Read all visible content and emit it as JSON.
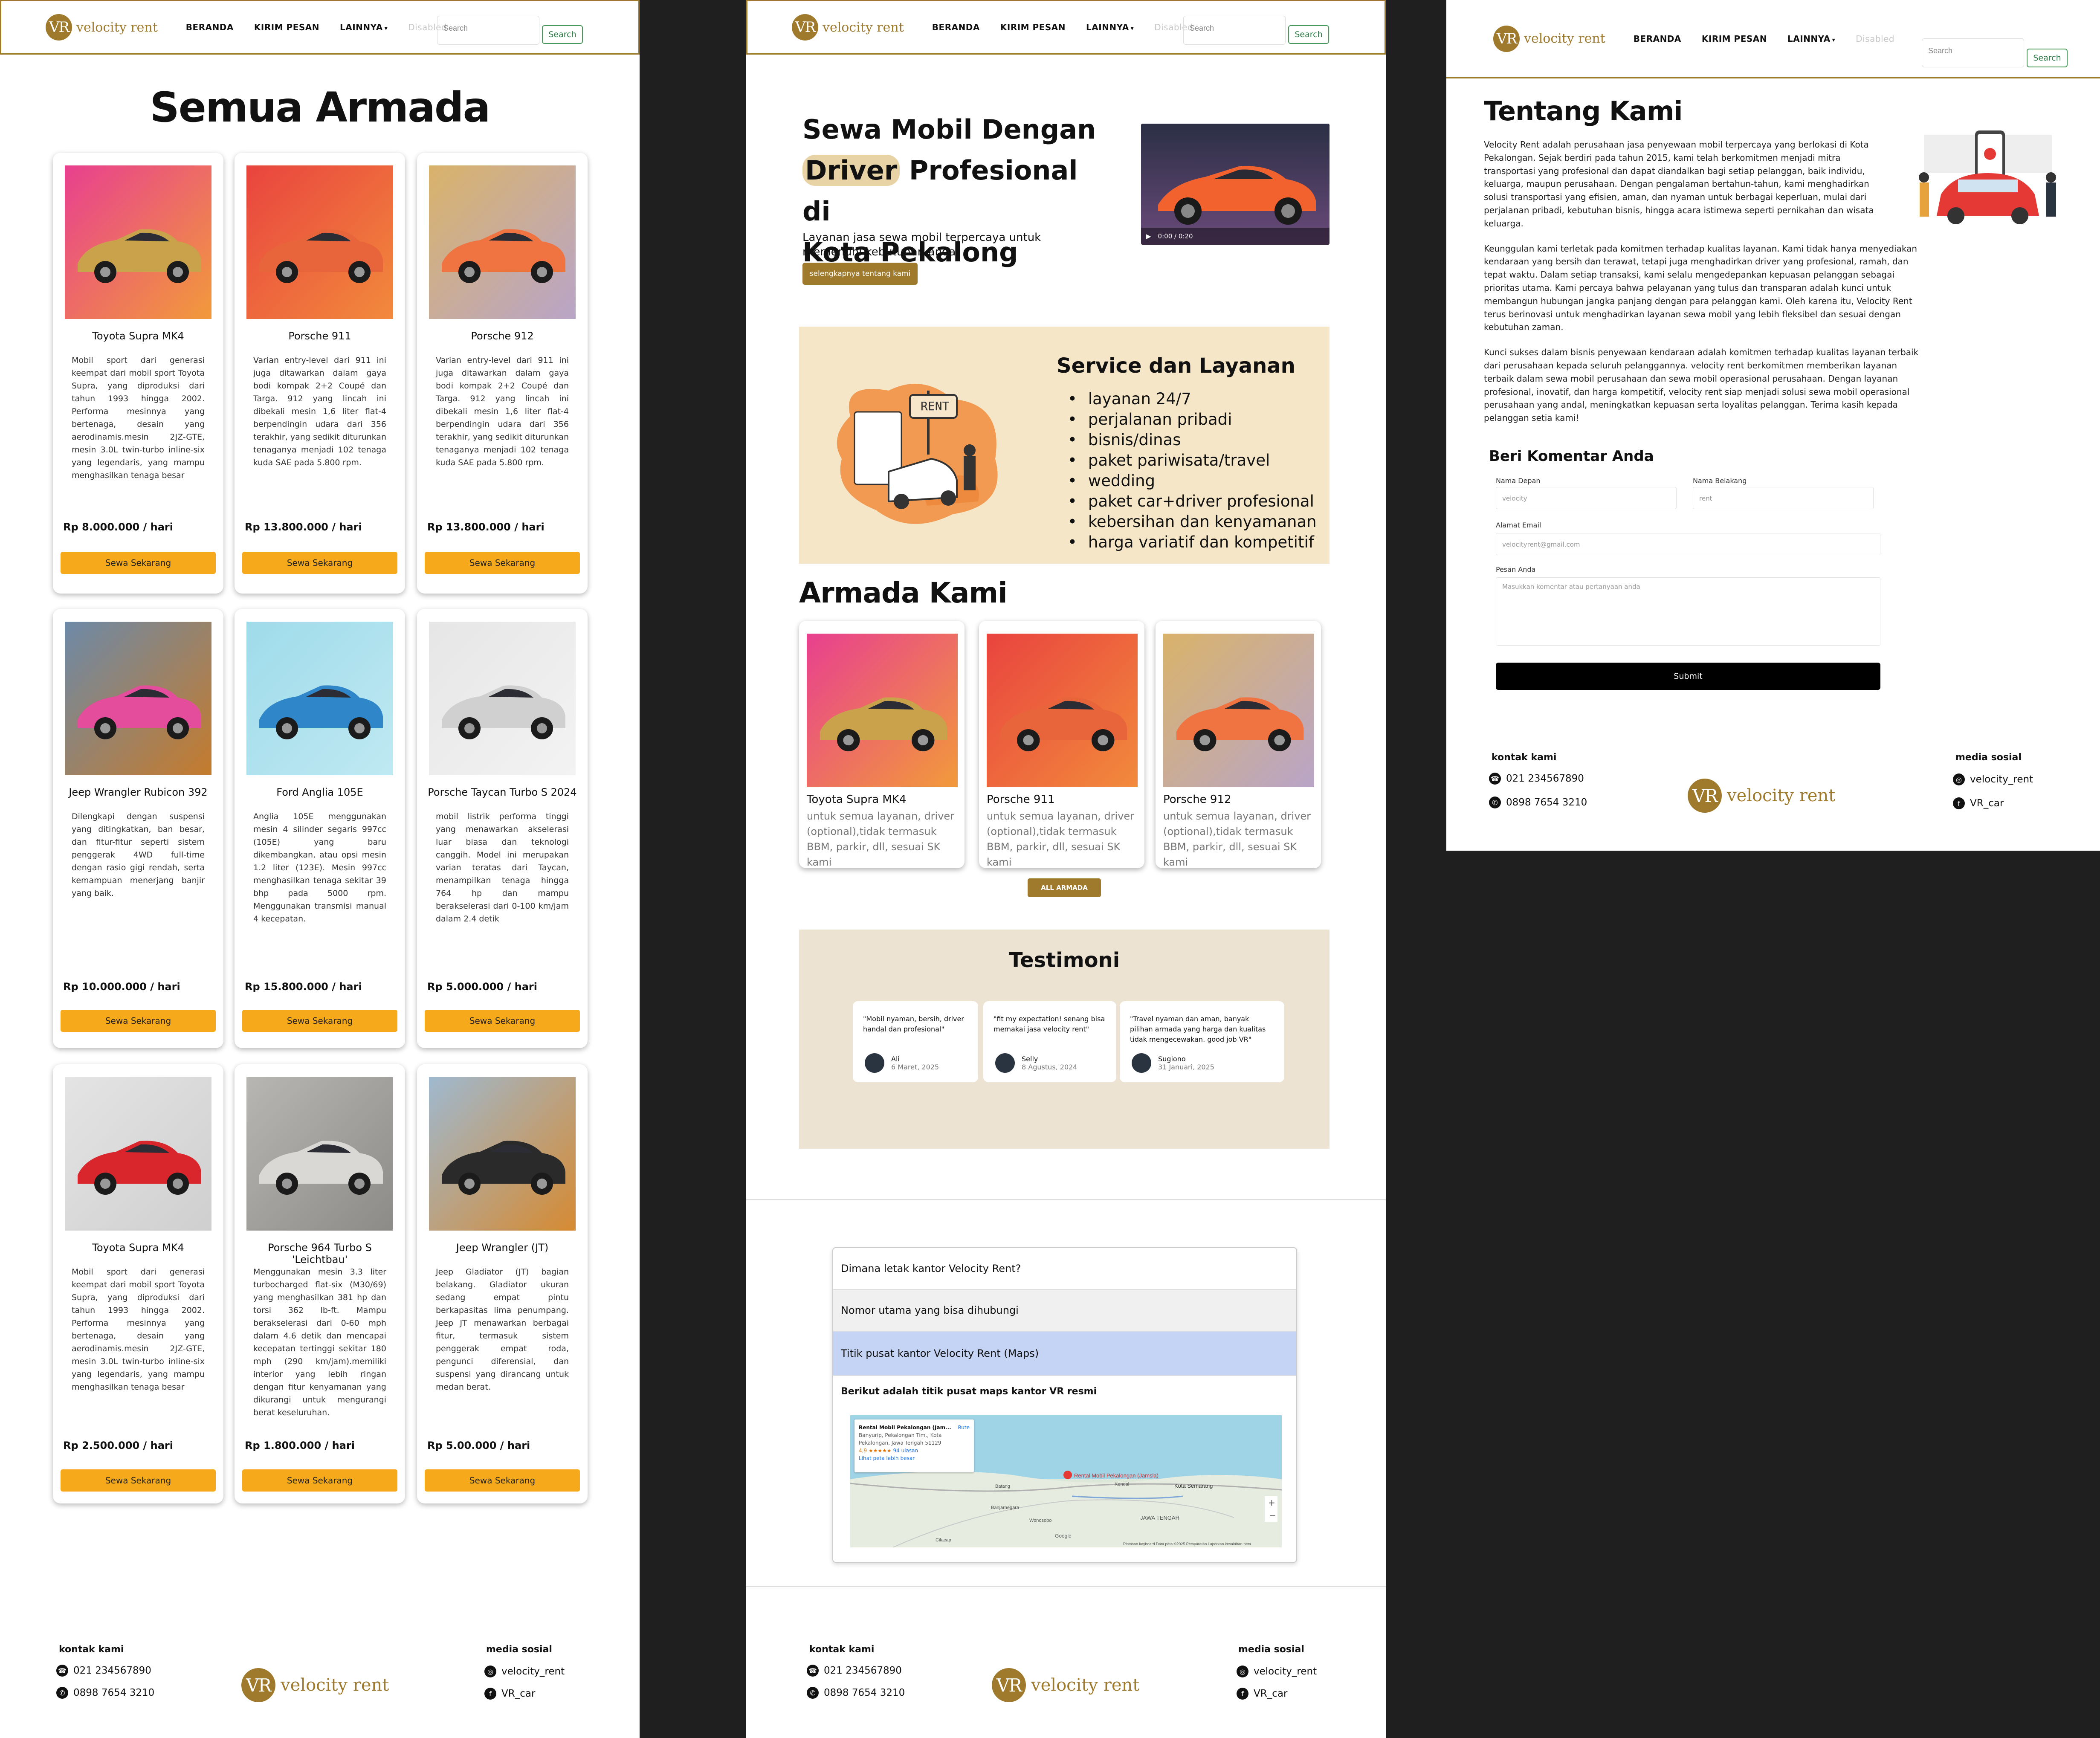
{
  "nav": {
    "logo_initials": "VR",
    "logo_text": "velocity rent",
    "links": [
      "BERANDA",
      "KIRIM PESAN",
      "LAINNYA"
    ],
    "disabled": "Disabled",
    "search_placeholder": "Search",
    "search_button": "Search"
  },
  "catalog": {
    "title": "Semua Armada",
    "button_label": "Sewa Sekarang",
    "cars": [
      {
        "name": "Toyota Supra MK4",
        "desc": "Mobil sport dari generasi keempat dari mobil sport Toyota Supra, yang diproduksi dari tahun 1993 hingga 2002. Performa mesinnya yang bertenaga, desain yang aerodinamis.mesin 2JZ-GTE, mesin 3.0L twin-turbo inline-six yang legendaris, yang mampu menghasilkan tenaga besar",
        "price": "Rp 8.000.000 / hari",
        "image": "supra-pink-bg",
        "colors": [
          "#e8408f",
          "#f29a3a",
          "#c9a24b"
        ]
      },
      {
        "name": "Porsche 911",
        "desc": "Varian entry-level dari 911 ini juga ditawarkan dalam gaya bodi kompak 2+2 Coupé dan Targa. 912 yang lincah ini dibekali mesin 1,6 liter flat-4 berpendingin udara dari 356 terakhir, yang sedikit diturunkan tenaganya menjadi 102 tenaga kuda SAE pada 5.800 rpm.",
        "price": "Rp 13.800.000 / hari",
        "image": "porsche911-orange-bg",
        "colors": [
          "#e9443e",
          "#f28a3c",
          "#e8643a"
        ]
      },
      {
        "name": "Porsche 912",
        "desc": "Varian entry-level dari 911 ini juga ditawarkan dalam gaya bodi kompak 2+2 Coupé dan Targa. 912 yang lincah ini dibekali mesin 1,6 liter flat-4 berpendingin udara dari 356 terakhir, yang sedikit diturunkan tenaganya menjadi 102 tenaga kuda SAE pada 5.800 rpm.",
        "price": "Rp 13.800.000 / hari",
        "image": "porsche912-peach-bg",
        "colors": [
          "#d9b36a",
          "#b9a5c8",
          "#ef7442"
        ]
      },
      {
        "name": "Jeep Wrangler Rubicon 392",
        "desc": "Dilengkapi dengan suspensi yang ditingkatkan, ban besar, dan fitur-fitur seperti sistem penggerak 4WD full-time dengan rasio gigi rendah, serta kemampuan menerjang banjir yang baik.",
        "price": "Rp 10.000.000 / hari",
        "image": "jeep-autumn-mountains",
        "colors": [
          "#6d8aa8",
          "#c57b2c",
          "#e34d9b"
        ]
      },
      {
        "name": "Ford Anglia 105E",
        "desc": "Anglia 105E menggunakan mesin 4 silinder segaris 997cc (105E) yang baru dikembangkan, atau opsi mesin 1.2 liter (123E). Mesin 997cc menghasilkan tenaga sekitar 39 bhp pada 5000 rpm. Menggunakan transmisi manual 4 kecepatan.",
        "price": "Rp 15.800.000 / hari",
        "image": "anglia-blue-bg",
        "colors": [
          "#9fdbea",
          "#bfe9f2",
          "#2f86c9"
        ]
      },
      {
        "name": "Porsche Taycan Turbo S 2024",
        "desc": "mobil listrik performa tinggi yang menawarkan akselerasi luar biasa dan teknologi canggih. Model ini merupakan varian teratas dari Taycan, menampilkan tenaga hingga 764 hp dan mampu berakselerasi dari 0-100 km/jam dalam 2.4 detik",
        "price": "Rp 5.000.000 / hari",
        "image": "taycan-white-studio",
        "colors": [
          "#e6e6e6",
          "#f3f3f3",
          "#d0d0d0"
        ]
      },
      {
        "name": "Toyota Supra MK4",
        "desc": "Mobil sport dari generasi keempat dari mobil sport Toyota Supra, yang diproduksi dari tahun 1993 hingga 2002. Performa mesinnya yang bertenaga, desain yang aerodinamis.mesin 2JZ-GTE, mesin 3.0L twin-turbo inline-six yang legendaris, yang mampu menghasilkan tenaga besar",
        "price": "Rp 2.500.000 / hari",
        "image": "red-hatchback-grey-studio",
        "colors": [
          "#e4e4e4",
          "#cfcfcf",
          "#d8262c"
        ]
      },
      {
        "name": "Porsche 964 Turbo S 'Leichtbau'",
        "desc": "Menggunakan mesin 3.3 liter turbocharged flat-six (M30/69) yang menghasilkan 381 hp dan torsi 362 lb-ft. Mampu berakselerasi dari 0-60 mph dalam 4.6 detik dan mencapai kecepatan tertinggi sekitar 180 mph (290 km/jam).memiliki interior yang lebih ringan dengan fitur kenyamanan yang dikurangi untuk mengurangi berat keseluruhan.",
        "price": "Rp 1.800.000 / hari",
        "image": "porsche964-silver-studio",
        "colors": [
          "#b8b6b2",
          "#8d8b88",
          "#d9d8d4"
        ]
      },
      {
        "name": "Jeep Wrangler (JT)",
        "desc": "Jeep Gladiator (JT) bagian belakang. Gladiator ukuran sedang empat pintu berkapasitas lima penumpang. Jeep JT menawarkan berbagai fitur, termasuk sistem penggerak empat roda, pengunci diferensial, dan suspensi yang dirancang untuk medan berat.",
        "price": "Rp 5.00.000 / hari",
        "image": "jeep-black-mountains",
        "colors": [
          "#9fb9cf",
          "#d68a32",
          "#2a2a2a"
        ]
      }
    ]
  },
  "home": {
    "hero_line1": "Sewa Mobil Dengan",
    "hero_highlight": "Driver",
    "hero_line2_rest": " Profesional di",
    "hero_line3": "Kota Pekalong",
    "hero_sub": "Layanan jasa sewa mobil terpercaya untuk memenuhi kebutuhan anda",
    "hero_button": "selengkapnya tentang kami",
    "video_time": "0:00 / 0:20",
    "service_title": "Service dan Layanan",
    "service_rent_sign": "RENT",
    "services": [
      "layanan 24/7",
      "perjalanan pribadi",
      "bisnis/dinas",
      "paket pariwisata/travel",
      "wedding",
      "paket car+driver profesional",
      "kebersihan dan kenyamanan",
      "harga variatif dan kompetitif"
    ],
    "armada_title": "Armada Kami",
    "armada_desc": "untuk semua layanan, driver (optional),tidak termasuk BBM, parkir, dll, sesuai SK kami",
    "armada_names": [
      "Toyota Supra MK4",
      "Porsche 911",
      "Porsche 912"
    ],
    "all_button": "ALL ARMADA",
    "testimoni_title": "Testimoni",
    "testimonials": [
      {
        "quote": "\"Mobil nyaman, bersih, driver handal dan profesional\"",
        "name": "Ali",
        "date": "6 Maret, 2025"
      },
      {
        "quote": "\"fit my expectation! senang bisa memakai jasa velocity rent\"",
        "name": "Selly",
        "date": "8 Agustus, 2024"
      },
      {
        "quote": "\"Travel nyaman dan aman, banyak pilihan armada yang harga dan kualitas tidak mengecewakan. good job VR\"",
        "name": "Sugiono",
        "date": "31 Januari, 2025"
      }
    ],
    "faq": [
      "Dimana letak kantor Velocity Rent?",
      "Nomor utama yang bisa dihubungi",
      "Titik pusat kantor Velocity Rent (Maps)"
    ],
    "faq_answer": "Berikut adalah titik pusat maps kantor VR resmi",
    "map_title": "Rental Mobil Pekalongan (Jam...",
    "map_addr": "Banyurip, Pekalongan Tim., Kota Pekalongan, Jawa Tengah 51129",
    "map_rating": "4,9 ★★★★★",
    "map_reviews": "94 ulasan",
    "map_link": "Lihat peta lebih besar",
    "map_route": "Rute",
    "map_pin_label": "Rental Mobil Pekalongan (Jamsla)",
    "map_places": [
      "Kota Semarang",
      "JAWA TENGAH",
      "Batang",
      "Kendal",
      "Banjarnegara",
      "Wonosobo",
      "Cilacap"
    ],
    "map_credits": "Pintasan keyboard   Data peta ©2025   Persyaratan   Laporkan kesalahan peta",
    "map_google": "Google"
  },
  "about": {
    "title": "Tentang Kami",
    "paragraphs": [
      "Velocity Rent adalah perusahaan jasa penyewaan mobil terpercaya yang berlokasi di Kota Pekalongan. Sejak berdiri pada tahun 2015, kami telah berkomitmen menjadi mitra transportasi yang profesional dan dapat diandalkan bagi setiap pelanggan, baik individu, keluarga, maupun perusahaan. Dengan pengalaman bertahun-tahun, kami menghadirkan solusi transportasi yang efisien, aman, dan nyaman untuk berbagai keperluan, mulai dari perjalanan pribadi, kebutuhan bisnis, hingga acara istimewa seperti pernikahan dan wisata keluarga.",
      "Keunggulan kami terletak pada komitmen terhadap kualitas layanan. Kami tidak hanya menyediakan kendaraan yang bersih dan terawat, tetapi juga menghadirkan driver yang profesional, ramah, dan tepat waktu. Dalam setiap transaksi, kami selalu mengedepankan kepuasan pelanggan sebagai prioritas utama. Kami percaya bahwa pelayanan yang tulus dan transparan adalah kunci untuk membangun hubungan jangka panjang dengan para pelanggan kami. Oleh karena itu, Velocity Rent terus berinovasi untuk menghadirkan layanan sewa mobil yang lebih fleksibel dan sesuai dengan kebutuhan zaman.",
      "Kunci sukses dalam bisnis penyewaan kendaraan adalah komitmen terhadap kualitas layanan terbaik dari perusahaan kepada seluruh pelanggannya. velocity rent berkomitmen memberikan layanan terbaik dalam sewa mobil perusahaan dan sewa mobil operasional perusahaan. Dengan layanan profesional, inovatif, dan harga kompetitif, velocity rent siap menjadi solusi sewa mobil operasional perusahaan yang andal, meningkatkan kepuasan serta loyalitas pelanggan. Terima kasih kepada pelanggan setia kami!"
    ],
    "form_title": "Beri Komentar Anda",
    "label_first": "Nama Depan",
    "label_last": "Nama Belakang",
    "label_email": "Alamat Email",
    "label_msg": "Pesan Anda",
    "ph_first": "velocity",
    "ph_last": "rent",
    "ph_email": "velocityrent@gmail.com",
    "ph_msg": "Masukkan komentar atau pertanyaan anda",
    "submit": "Submit"
  },
  "footer": {
    "contact_title": "kontak kami",
    "phone": "021 234567890",
    "whatsapp": "0898 7654 3210",
    "social_title": "media sosial",
    "instagram": "velocity_rent",
    "facebook": "VR_car"
  },
  "colors": {
    "brand": "#a07a2c",
    "button_orange": "#f6a91b",
    "service_bg": "#f5e6c8",
    "testimoni_bg": "#ede3d2",
    "faq_active": "#c5d4f5"
  }
}
